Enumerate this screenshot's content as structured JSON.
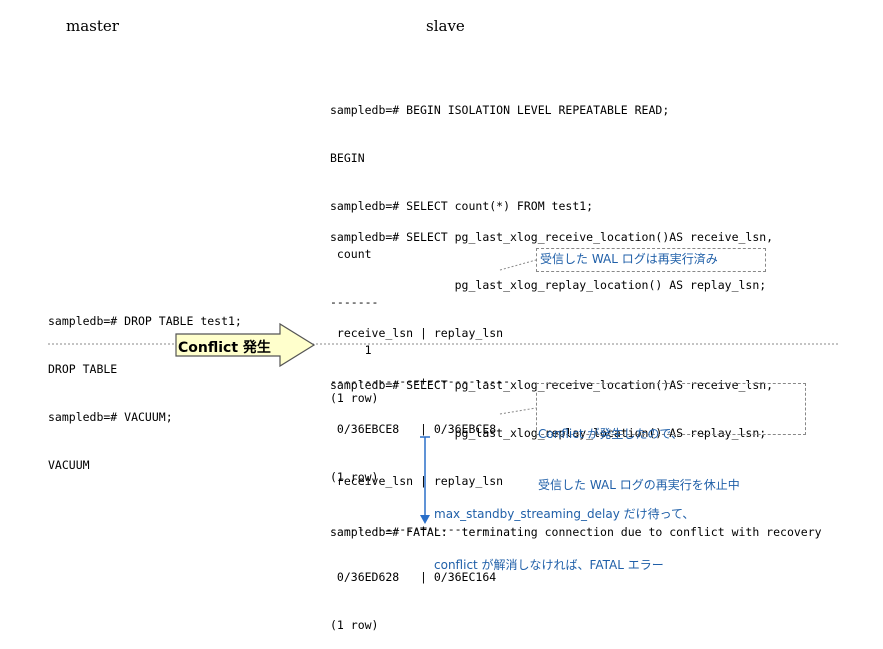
{
  "headers": {
    "master": "master",
    "slave": "slave"
  },
  "slave_block1": [
    "sampledb=# BEGIN ISOLATION LEVEL REPEATABLE READ;",
    "BEGIN",
    "sampledb=# SELECT count(*) FROM test1;",
    " count",
    "-------",
    "     1",
    "(1 row)"
  ],
  "slave_block2": [
    "sampledb=# SELECT pg_last_xlog_receive_location()AS receive_lsn,",
    "                  pg_last_xlog_replay_location() AS replay_lsn;",
    " receive_lsn | replay_lsn",
    "-------------+------------",
    " 0/36EBCE8   | 0/36EBCE8",
    "(1 row)"
  ],
  "master_block": [
    "sampledb=# DROP TABLE test1;",
    "DROP TABLE",
    "sampledb=# VACUUM;",
    "VACUUM"
  ],
  "conflict_label": "Conflict 発生",
  "slave_block3": [
    "sampledb=# SELECT pg_last_xlog_receive_location()AS receive_lsn,",
    "                  pg_last_xlog_replay_location() AS replay_lsn;",
    " receive_lsn | replay_lsn",
    "-------------+------------",
    " 0/36ED628   | 0/36EC164",
    "(1 row)"
  ],
  "annotations": {
    "replayed": "受信した WAL ログは再実行済み",
    "paused_line1": "Conflict が発生したので、",
    "paused_line2": "受信した WAL ログの再実行を休止中",
    "delay_line1": "max_standby_streaming_delay だけ待って、",
    "delay_line2": "conflict が解消しなければ、FATAL エラー"
  },
  "fatal_line": "sampledb=# FATAL:  terminating connection due to conflict with recovery",
  "colors": {
    "annotation": "#1f5fa8",
    "arrow_fill": "#ffffcc",
    "arrow_stroke": "#555555",
    "timeline": "#2a6fc9"
  }
}
